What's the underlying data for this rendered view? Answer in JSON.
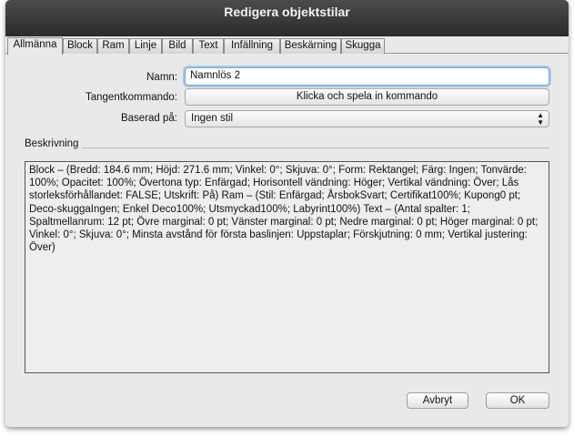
{
  "window": {
    "title": "Redigera objektstilar"
  },
  "tabs": [
    {
      "label": "Allmänna",
      "active": true
    },
    {
      "label": "Block"
    },
    {
      "label": "Ram"
    },
    {
      "label": "Linje"
    },
    {
      "label": "Bild"
    },
    {
      "label": "Text"
    },
    {
      "label": "Infällning"
    },
    {
      "label": "Beskärning"
    },
    {
      "label": "Skugga"
    }
  ],
  "form": {
    "name_label": "Namn:",
    "name_value": "Namnlös 2",
    "shortcut_label": "Tangentkommando:",
    "shortcut_button": "Klicka och spela in kommando",
    "based_on_label": "Baserad på:",
    "based_on_value": "Ingen stil"
  },
  "description": {
    "title": "Beskrivning",
    "text": "Block – (Bredd: 184.6 mm; Höjd: 271.6 mm; Vinkel: 0°; Skjuva: 0°; Form: Rektangel; Färg: Ingen; Tonvärde: 100%; Opacitet: 100%; Övertona typ: Enfärgad; Horisontell vändning: Höger; Vertikal vändning: Över; Lås storleksförhållandet: FALSE; Utskrift: På) Ram – (Stil: Enfärgad; ÅrsbokSvart; Certifikat100%; Kupong0 pt; Deco-skuggaIngen; Enkel Deco100%; Utsmyckad100%; Labyrint100%) Text – (Antal spalter: 1; Spaltmellanrum: 12 pt; Övre marginal: 0 pt; Vänster marginal: 0 pt; Nedre marginal: 0 pt; Höger  marginal: 0 pt; Vinkel: 0°; Skjuva: 0°; Minsta avstånd för första baslinjen: Uppstaplar; Förskjutning: 0 mm; Vertikal justering: Över)"
  },
  "buttons": {
    "cancel": "Avbryt",
    "ok": "OK"
  },
  "icons": {
    "select_arrows": "up-down-chevron-icon"
  },
  "colors": {
    "titlebar": "#3a3a3a",
    "focus_ring": "#a9c8ec",
    "window_bg": "#e9e9e9"
  }
}
